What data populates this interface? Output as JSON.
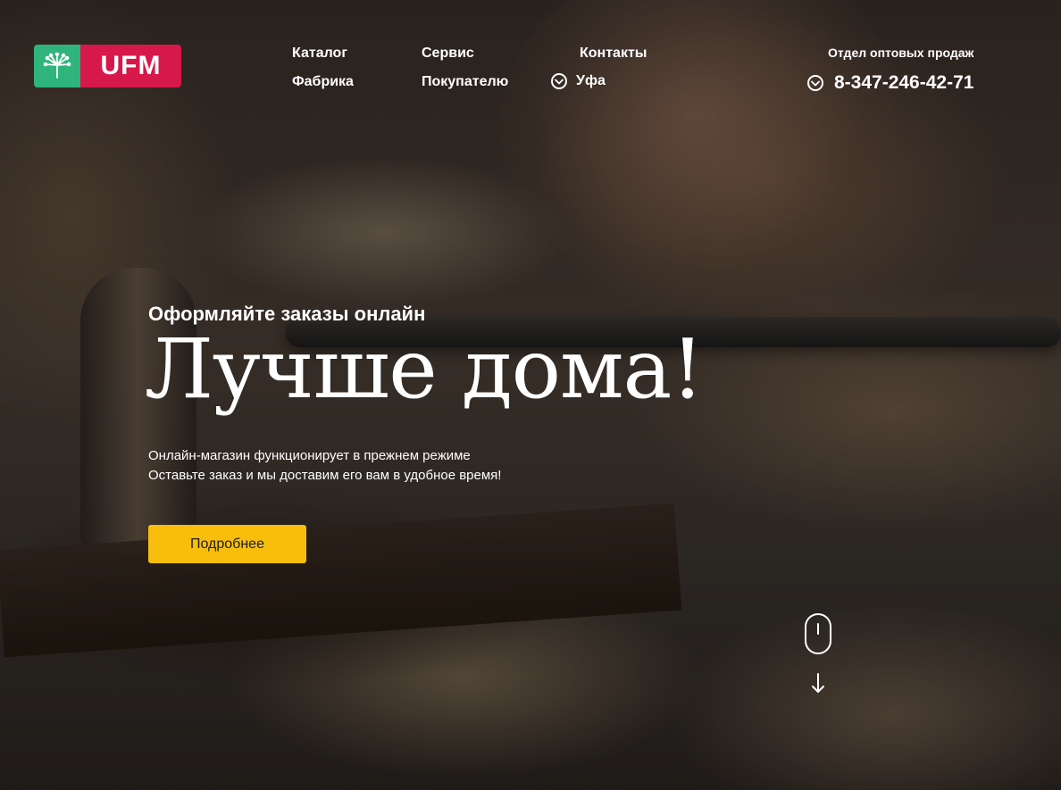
{
  "brand": {
    "name": "UFM"
  },
  "nav": {
    "items": [
      {
        "label": "Каталог"
      },
      {
        "label": "Сервис"
      },
      {
        "label": "Контакты"
      },
      {
        "label": "Фабрика"
      },
      {
        "label": "Покупателю"
      }
    ],
    "city": "Уфа"
  },
  "contact": {
    "wholesale_label": "Отдел оптовых продаж",
    "phone": "8-347-246-42-71"
  },
  "hero": {
    "subtitle": "Оформляйте заказы онлайн",
    "headline": "Лучше дома!",
    "description_lines": [
      "Онлайн-магазин функционирует в прежнем режиме",
      "Оставьте заказ и мы доставим его вам в удобное время!"
    ],
    "cta_label": "Подробнее"
  },
  "icons": {
    "logo": "dandelion-icon",
    "city_toggle": "chevron-down-circle-icon",
    "phone_toggle": "chevron-down-circle-icon",
    "scroll": "mouse-scroll-icon",
    "scroll_arrow": "arrow-down-icon"
  },
  "colors": {
    "logo_green": "#2fb47c",
    "logo_red": "#d6184a",
    "cta": "#f9be0c"
  }
}
